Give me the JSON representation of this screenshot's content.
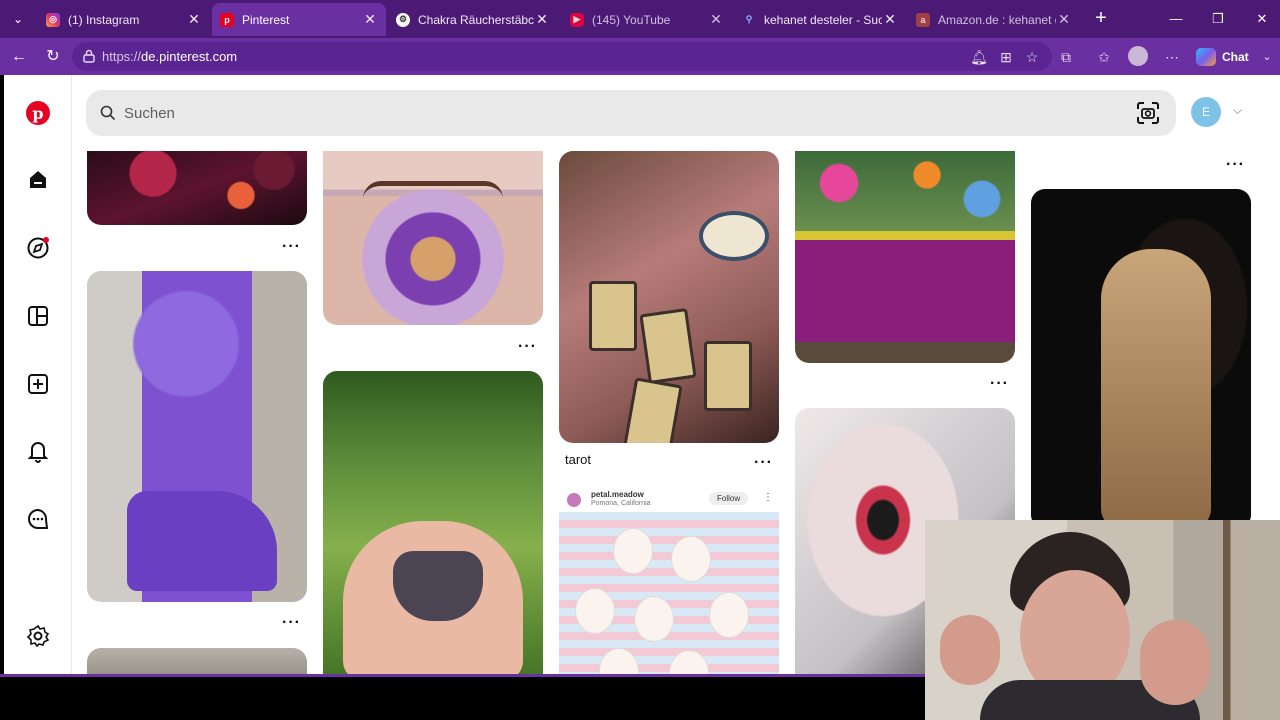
{
  "browser": {
    "tabs": [
      {
        "title": "(1) Instagram",
        "icon": "instagram-icon",
        "active": false
      },
      {
        "title": "Pinterest",
        "icon": "pinterest-icon",
        "active": true
      },
      {
        "title": "Chakra Räucherstäbchen",
        "icon": "chatgpt-icon",
        "active": false
      },
      {
        "title": "(145) YouTube",
        "icon": "youtube-icon",
        "active": false
      },
      {
        "title": "kehanet desteler - Suche",
        "icon": "search-icon",
        "active": false
      },
      {
        "title": "Amazon.de : kehanet de",
        "icon": "amazon-icon",
        "active": false
      }
    ],
    "url_prefix": "https://",
    "url_domain": "de.pinterest.com",
    "copilot_label": "Chat",
    "accent": "#6a2fa0"
  },
  "pinterest": {
    "search_placeholder": "Suchen",
    "avatar_initial": "E",
    "brand_color": "#e60023",
    "pins": {
      "tarot_title": "tarot",
      "clown_account": "petal.meadow",
      "clown_location": "Pomona, California",
      "clown_follow": "Follow"
    },
    "more_label": "···"
  }
}
